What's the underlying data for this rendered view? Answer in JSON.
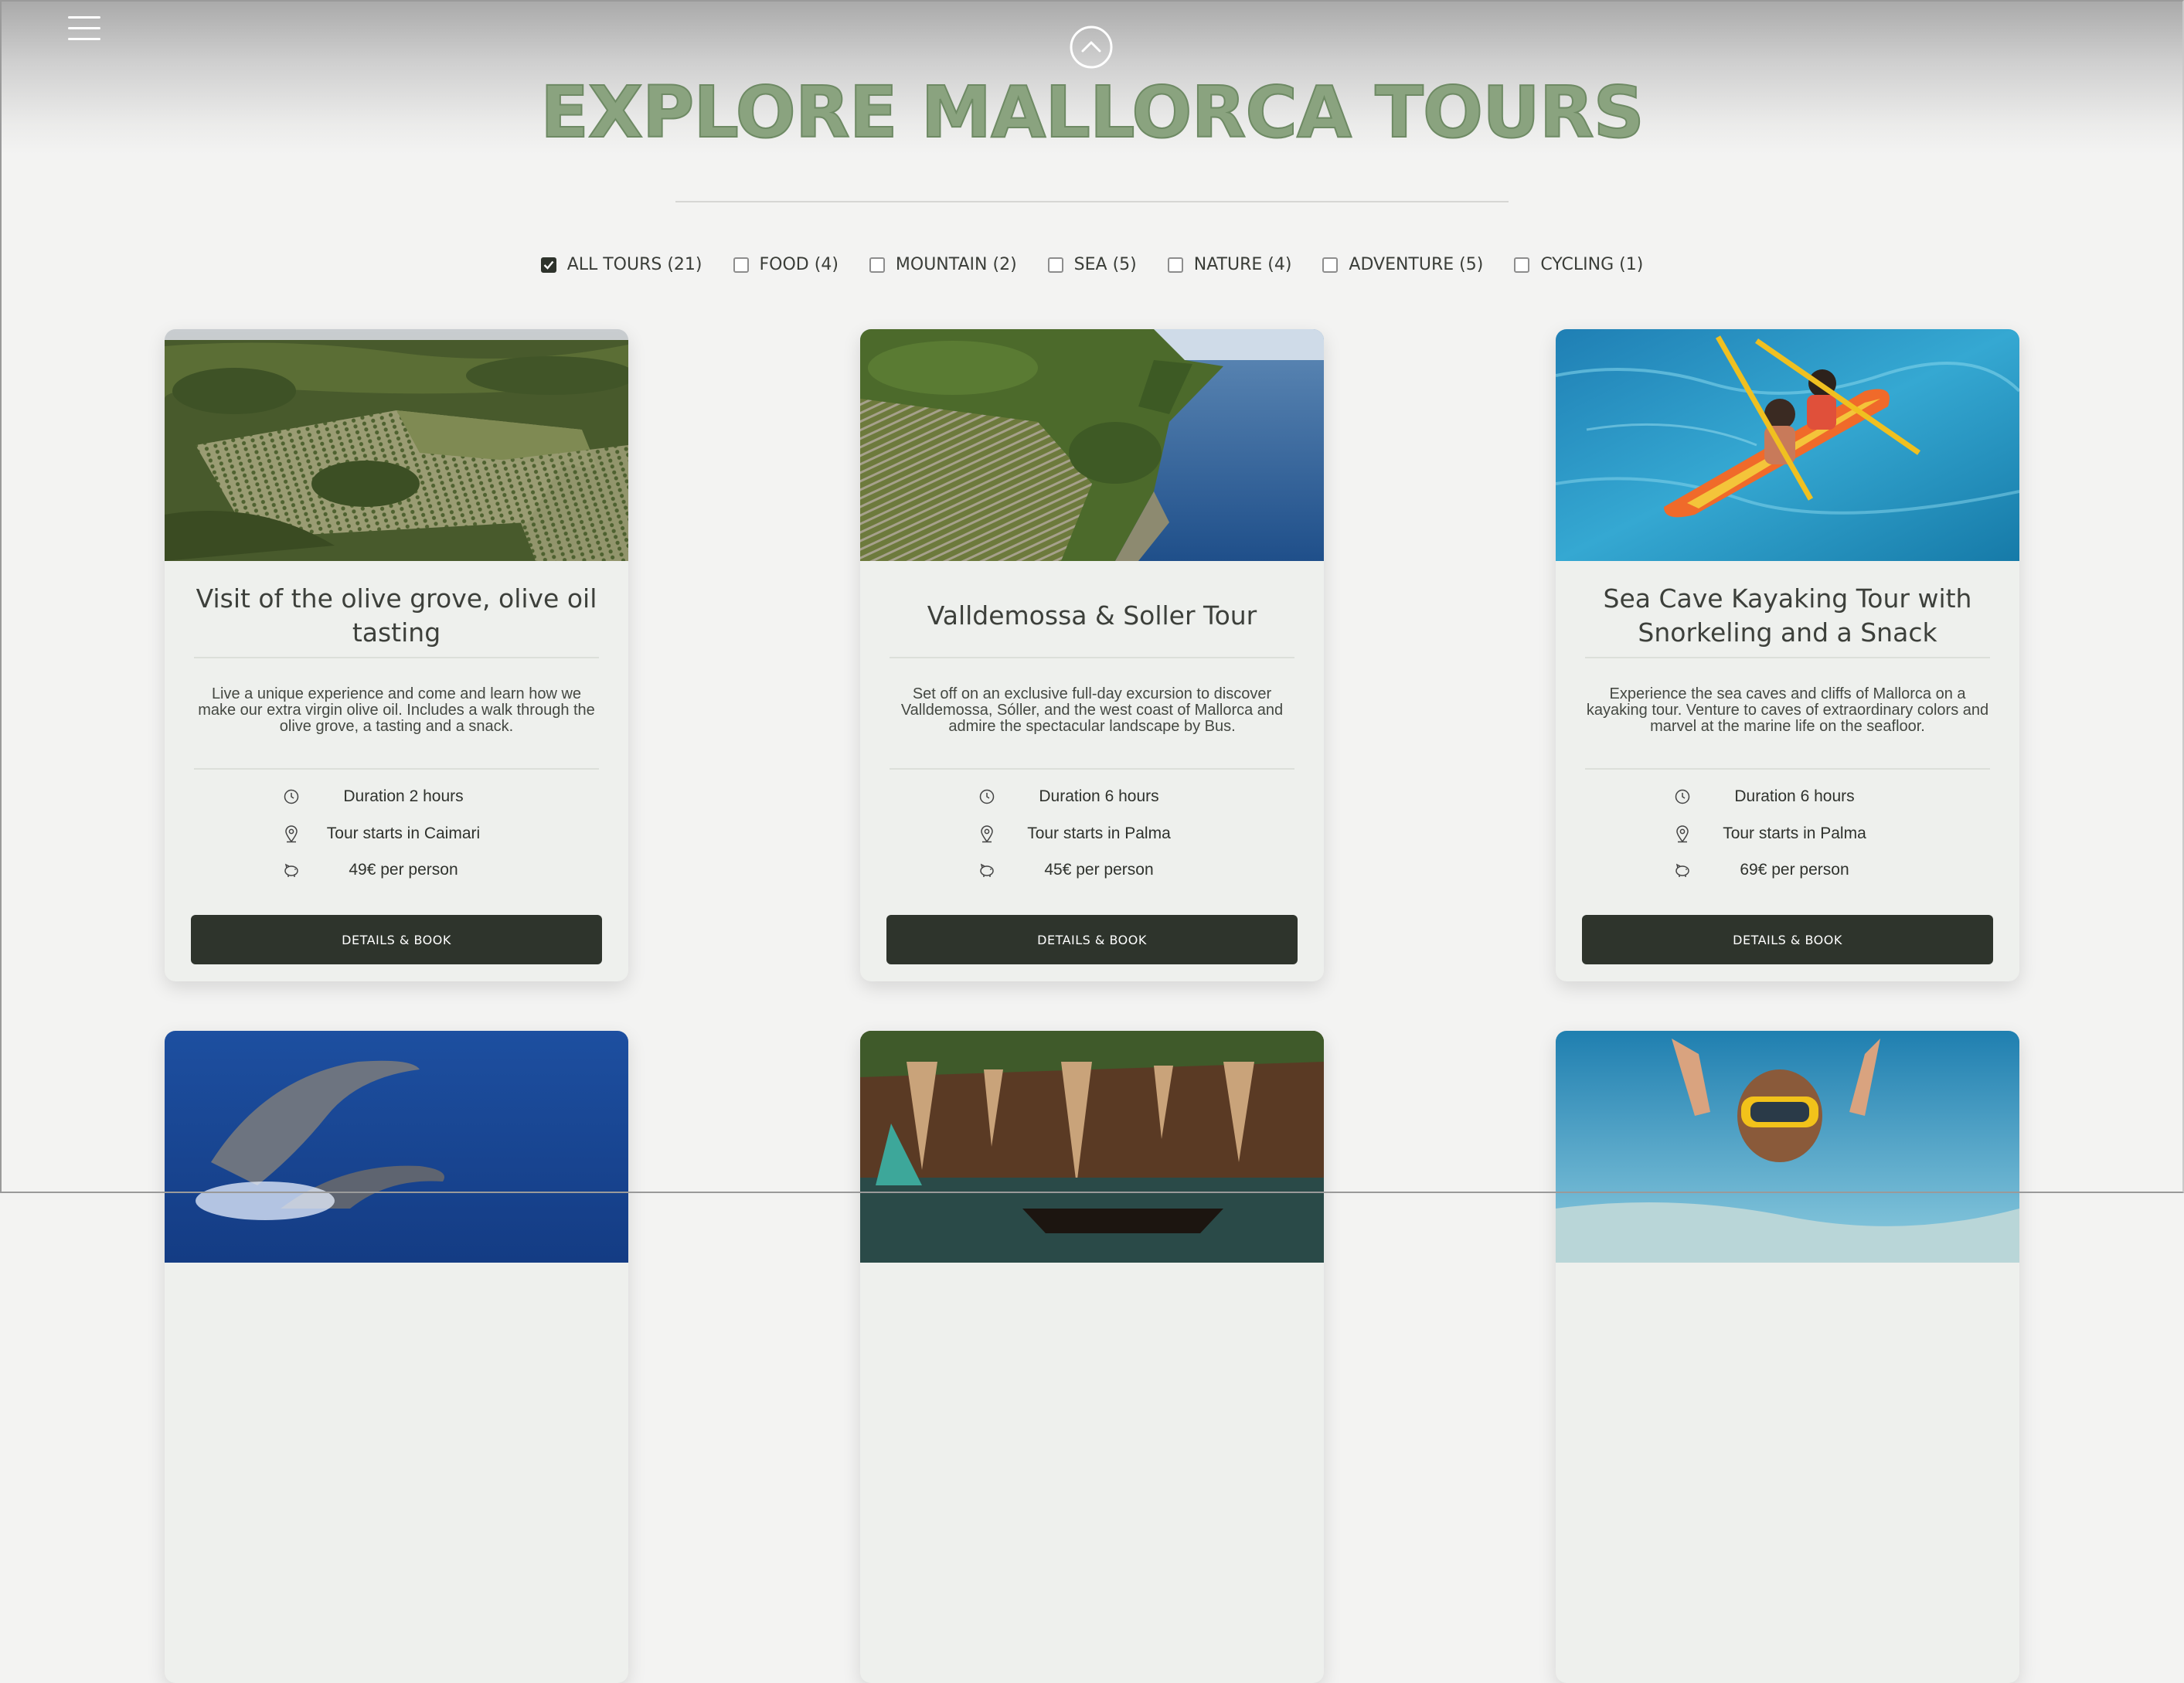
{
  "header": {
    "title": "EXPLORE MALLORCA TOURS",
    "menu_icon": "hamburger-menu-icon",
    "scroll_icon": "chevron-up-circle-icon"
  },
  "colors": {
    "title_green": "#8aa37f",
    "button_dark": "#2e342c",
    "background": "#f3f3f2",
    "card_bg": "#eef0ed"
  },
  "filters": [
    {
      "label": "ALL TOURS (21)",
      "checked": true
    },
    {
      "label": "FOOD (4)",
      "checked": false
    },
    {
      "label": "MOUNTAIN (2)",
      "checked": false
    },
    {
      "label": "SEA (5)",
      "checked": false
    },
    {
      "label": "NATURE (4)",
      "checked": false
    },
    {
      "label": "ADVENTURE (5)",
      "checked": false
    },
    {
      "label": "CYCLING (1)",
      "checked": false
    }
  ],
  "tours": [
    {
      "title": "Visit of the olive grove, olive oil tasting",
      "description": "Live a unique experience and come and learn how we make our extra virgin olive oil. Includes a walk through the olive grove, a tasting and a snack.",
      "duration": "Duration 2 hours",
      "start": "Tour starts in Caimari",
      "price": "49€ per person",
      "button": "DETAILS & BOOK",
      "image": "olive-grove-aerial-photo"
    },
    {
      "title": "Valldemossa & Soller Tour",
      "description": "Set off on an exclusive full-day excursion to discover Valldemossa, Sóller, and the west coast of Mallorca and admire the spectacular landscape by Bus.",
      "duration": "Duration 6 hours",
      "start": "Tour starts in Palma",
      "price": "45€ per person",
      "button": "DETAILS & BOOK",
      "image": "coastal-terraces-photo"
    },
    {
      "title": "Sea Cave Kayaking Tour with Snorkeling and a Snack",
      "description": "Experience the sea caves and cliffs of Mallorca on a kayaking tour. Venture to caves of extraordinary colors and marvel at the marine life on the seafloor.",
      "duration": "Duration 6 hours",
      "start": "Tour starts in Palma",
      "price": "69€ per person",
      "button": "DETAILS & BOOK",
      "image": "kayak-on-turquoise-water-photo"
    }
  ],
  "next_row": [
    {
      "image": "dolphins-photo"
    },
    {
      "image": "cave-boat-photo"
    },
    {
      "image": "snorkeling-diver-photo"
    }
  ]
}
